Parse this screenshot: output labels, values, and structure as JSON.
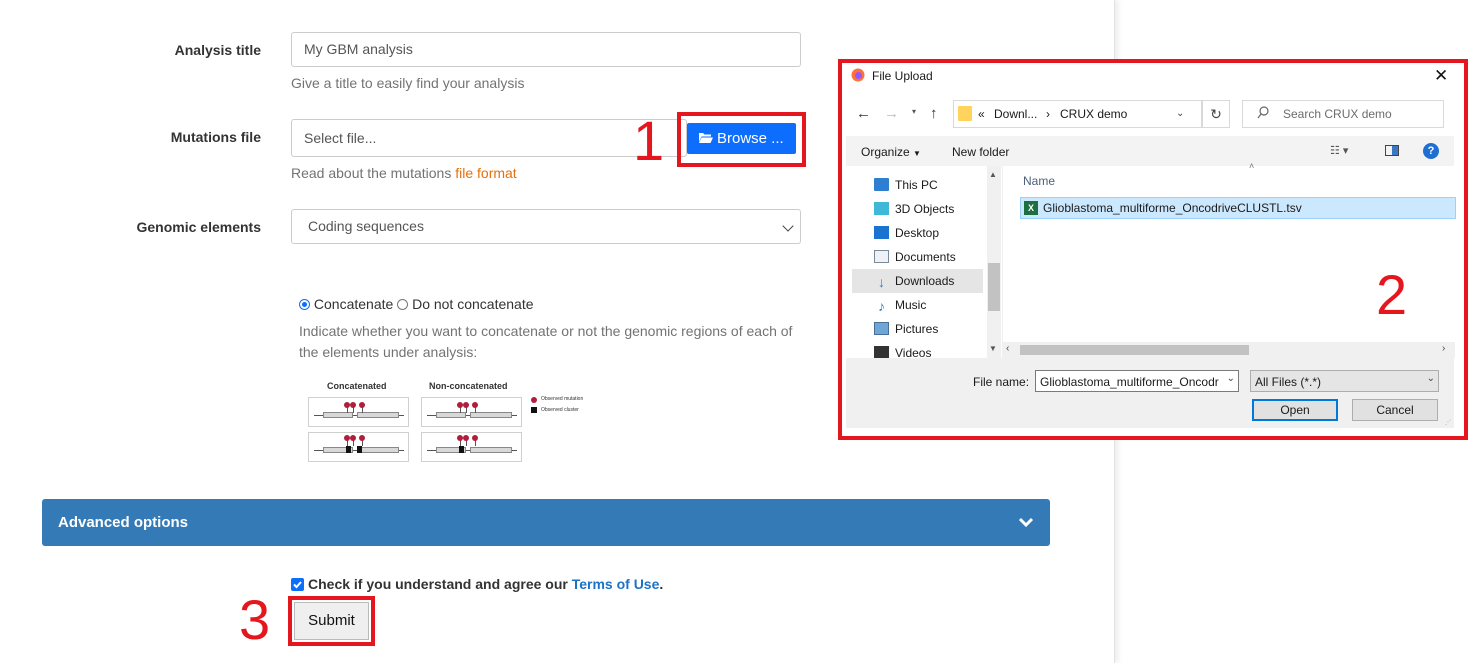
{
  "form": {
    "analysis_title_label": "Analysis title",
    "analysis_title_value": "My GBM analysis",
    "analysis_title_help": "Give a title to easily find your analysis",
    "mutations_label": "Mutations file",
    "mutations_placeholder": "Select file...",
    "browse_label": "Browse ...",
    "mutations_help": "Read about the mutations ",
    "mutations_help_link": "file format",
    "genomic_label": "Genomic elements",
    "genomic_value": "Coding sequences",
    "concat_option": "Concatenate",
    "no_concat_option": "Do not concatenate",
    "concat_help": "Indicate whether you want to concatenate or not the genomic regions of each of the elements under analysis:"
  },
  "diagram": {
    "concatenated_title": "Concatenated",
    "nonconcatenated_title": "Non-concatenated",
    "legend_mutation": "Observed mutation",
    "legend_cluster": "Observed cluster"
  },
  "advanced": {
    "label": "Advanced options"
  },
  "terms": {
    "text": "Check if you understand and agree our ",
    "link": "Terms of Use",
    "end": ".",
    "checked": true
  },
  "submit": {
    "label": "Submit"
  },
  "annotations": {
    "n1": "1",
    "n2": "2",
    "n3": "3",
    "color": "#e4171f"
  },
  "dialog": {
    "title": "File Upload",
    "path": [
      "«",
      "Downl...",
      "›",
      "CRUX demo"
    ],
    "search_placeholder": "Search CRUX demo",
    "organize": "Organize",
    "new_folder": "New folder",
    "column_name": "Name",
    "nav_items": [
      "This PC",
      "3D Objects",
      "Desktop",
      "Documents",
      "Downloads",
      "Music",
      "Pictures",
      "Videos"
    ],
    "file": "Glioblastoma_multiforme_OncodriveCLUSTL.tsv",
    "file_name_label": "File name:",
    "file_name_value": "Glioblastoma_multiforme_Oncodr",
    "filter_value": "All Files (*.*)",
    "open_label": "Open",
    "cancel_label": "Cancel"
  }
}
